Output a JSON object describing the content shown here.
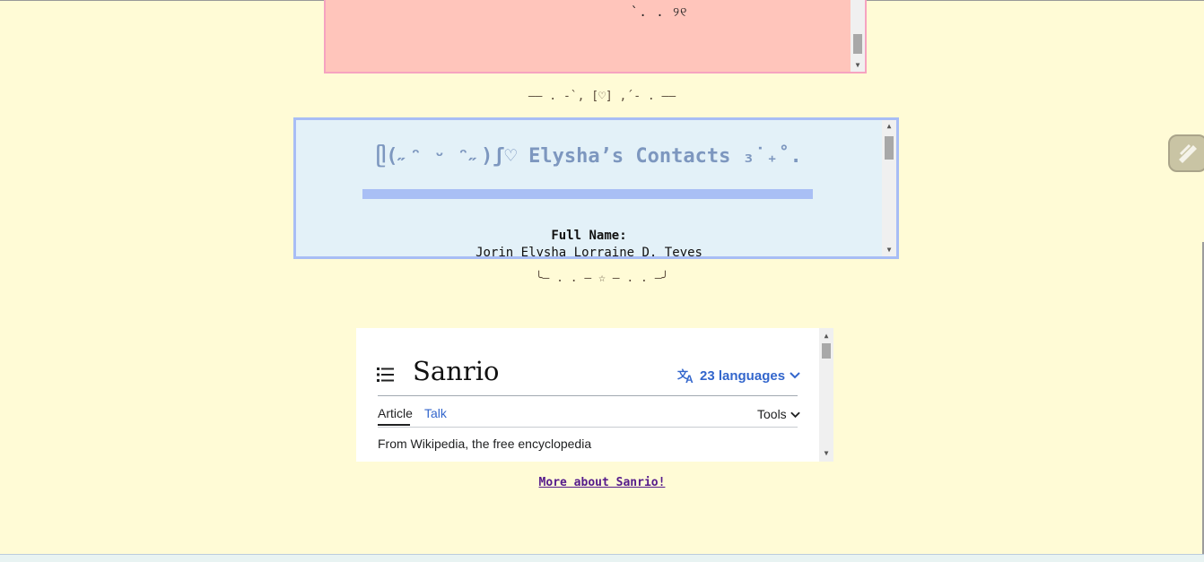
{
  "pink_box": {
    "kaomoji": "`. . ୨୧"
  },
  "dividers": {
    "top": "—— . -`, [♡] ,´- . ——",
    "bottom": "╰— . . — ☆ — . . —╯"
  },
  "contacts": {
    "heading": "ᥫ(˶ᵔ ᵕ ᵔ˶)ʃ♡ Elysha’s Contacts ₃˙₊˚.",
    "field_label": "Full Name:",
    "field_value": "Jorin Elysha Lorraine D. Teyes"
  },
  "wiki": {
    "title": "Sanrio",
    "languages": "23 languages",
    "tabs": [
      "Article",
      "Talk"
    ],
    "tools": "Tools",
    "tagline": "From Wikipedia, the free encyclopedia"
  },
  "more_link": "More about Sanrio!",
  "colors": {
    "page_bg": "#fffbd6",
    "pink_box_bg": "#ffc5bb",
    "pink_box_border": "#f6a3c0",
    "blue_box_bg": "#e3f1f8",
    "blue_box_border": "#a8bdf5",
    "wiki_link": "#3366cc",
    "visited_link": "#551a8b"
  }
}
